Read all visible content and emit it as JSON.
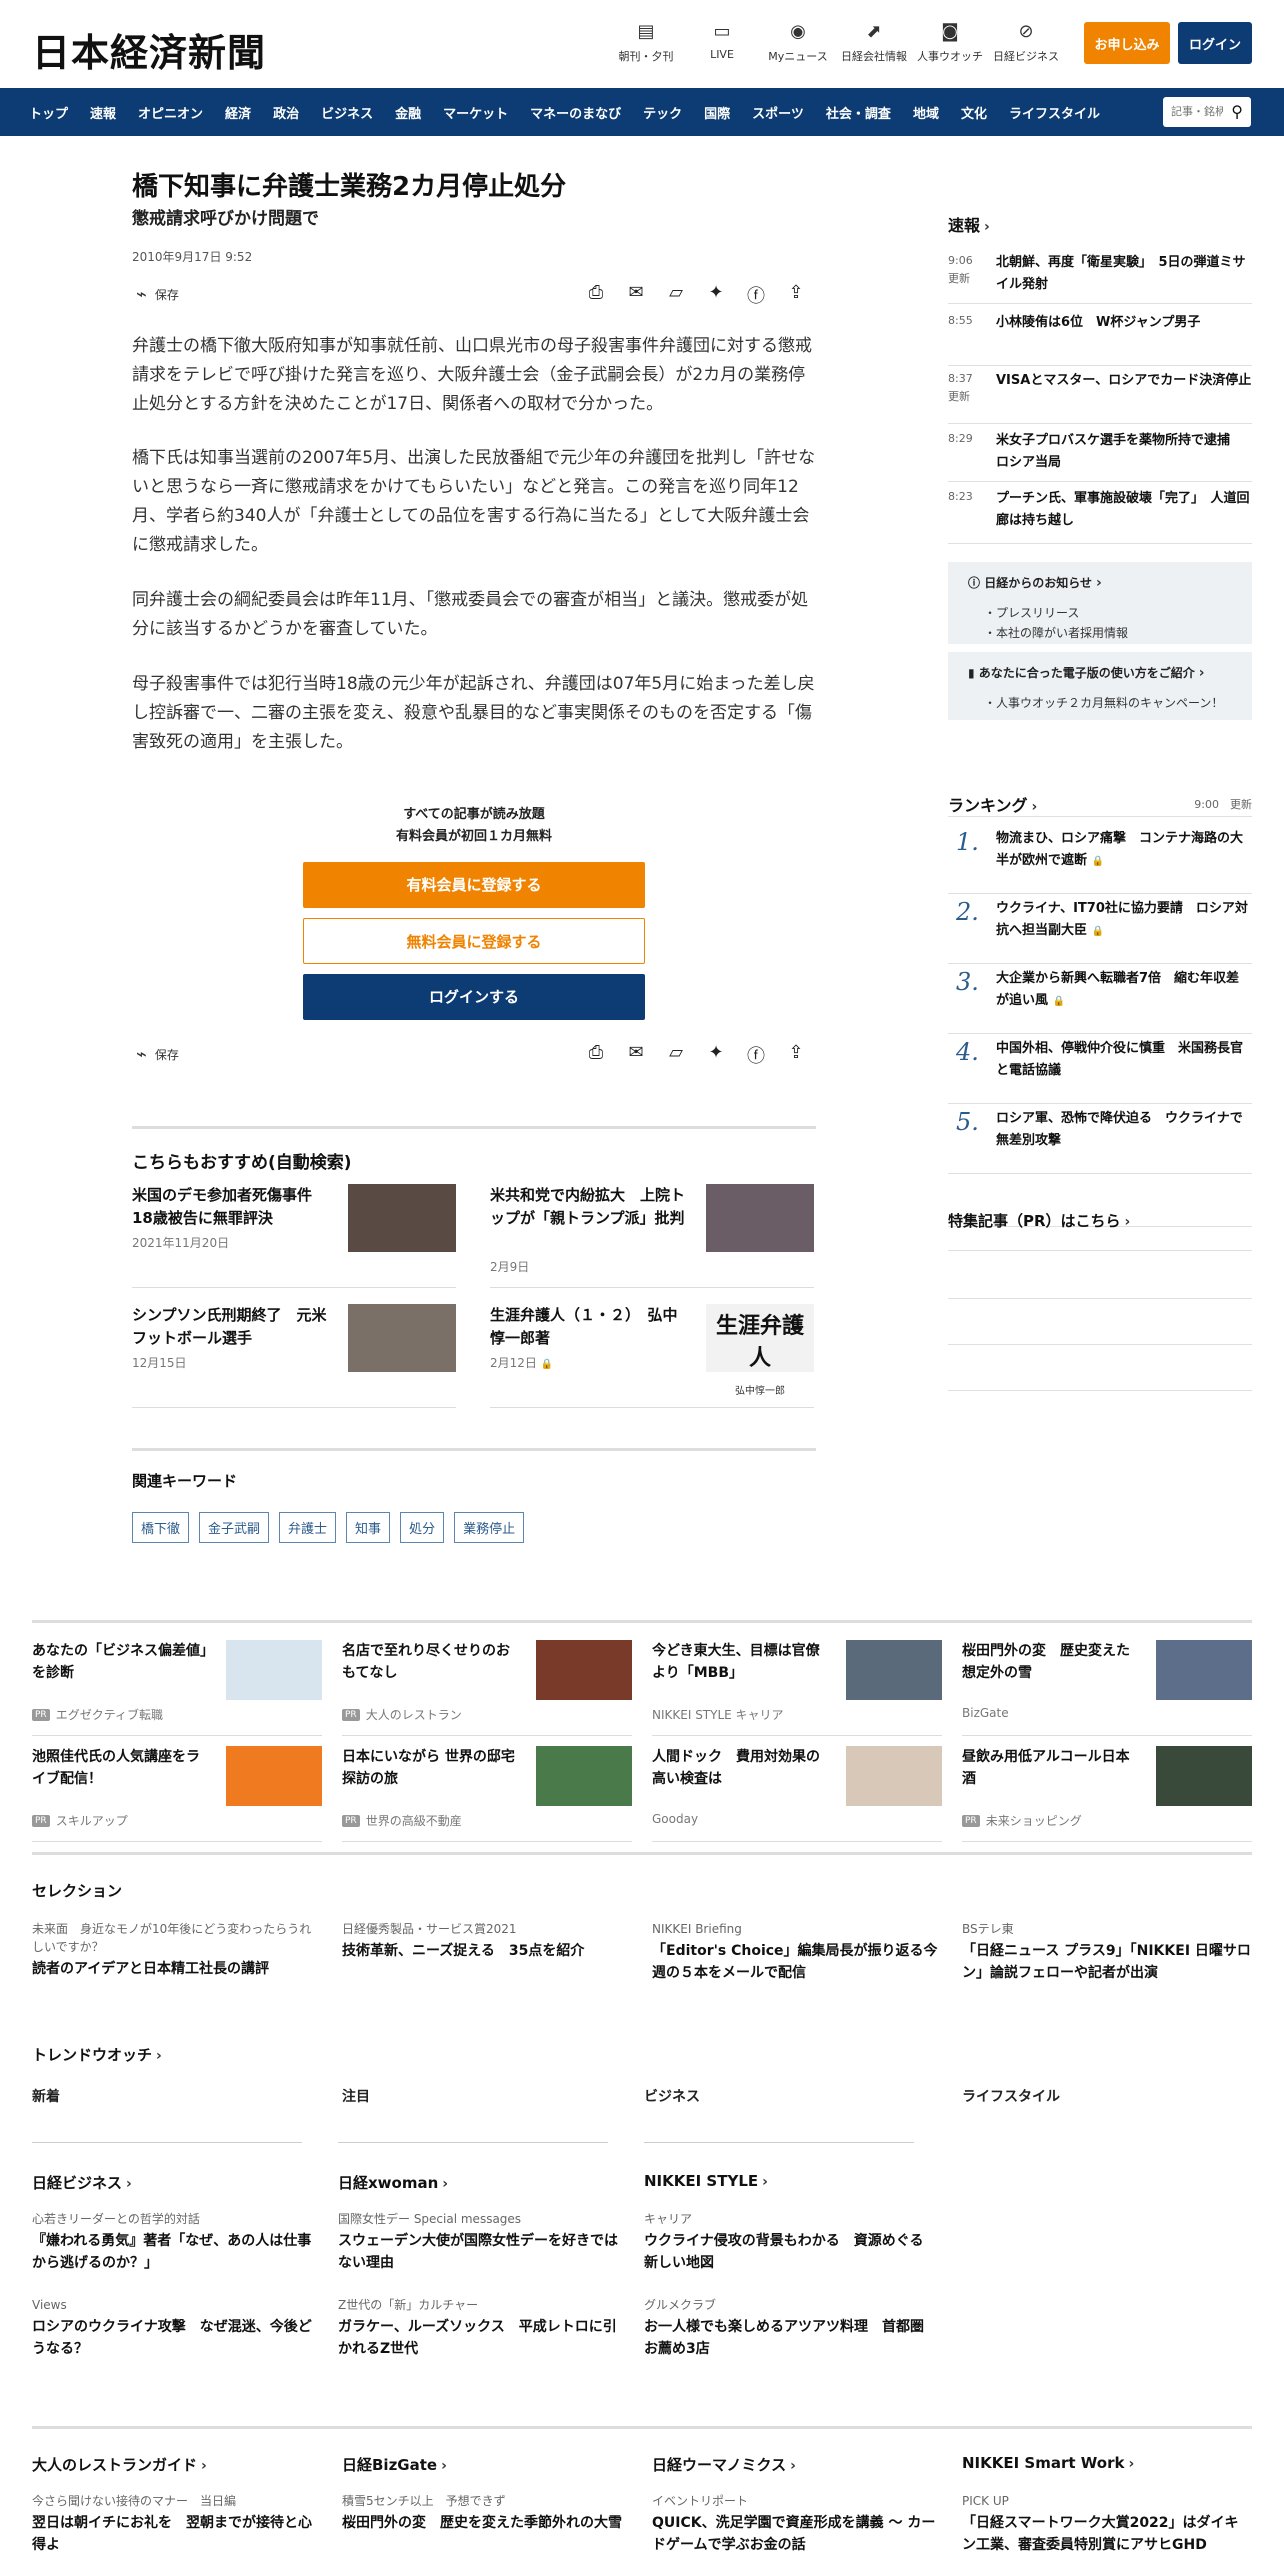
{
  "header": {
    "logo": "日本経済新聞",
    "links": [
      {
        "label": "朝刊・夕刊",
        "icon": "newspaper-icon"
      },
      {
        "label": "LIVE",
        "icon": "video-icon"
      },
      {
        "label": "Myニュース",
        "icon": "user-icon"
      },
      {
        "label": "日経会社情報",
        "icon": "chart-icon"
      },
      {
        "label": "人事ウオッチ",
        "icon": "search-person-icon"
      },
      {
        "label": "日経ビジネス",
        "icon": "compass-icon"
      }
    ],
    "apply_label": "お申し込み",
    "login_label": "ログイン"
  },
  "nav": {
    "items": [
      "トップ",
      "速報",
      "オピニオン",
      "経済",
      "政治",
      "ビジネス",
      "金融",
      "マーケット",
      "マネーのまなび",
      "テック",
      "国際",
      "スポーツ",
      "社会・調査",
      "地域",
      "文化",
      "ライフスタイル"
    ],
    "search_placeholder": "記事・銘柄"
  },
  "article": {
    "title": "橋下知事に弁護士業務2カ月停止処分",
    "subtitle": "懲戒請求呼びかけ問題で",
    "date": "2010年9月17日 9:52",
    "save_label": "保存",
    "paragraphs": [
      "弁護士の橋下徹大阪府知事が知事就任前、山口県光市の母子殺害事件弁護団に対する懲戒請求をテレビで呼び掛けた発言を巡り、大阪弁護士会（金子武嗣会長）が2カ月の業務停止処分とする方針を決めたことが17日、関係者への取材で分かった。",
      "橋下氏は知事当選前の2007年5月、出演した民放番組で元少年の弁護団を批判し「許せないと思うなら一斉に懲戒請求をかけてもらいたい」などと発言。この発言を巡り同年12月、学者ら約340人が「弁護士としての品位を害する行為に当たる」として大阪弁護士会に懲戒請求した。",
      "同弁護士会の綱紀委員会は昨年11月、「懲戒委員会での審査が相当」と議決。懲戒委が処分に該当するかどうかを審査していた。",
      "母子殺害事件では犯行当時18歳の元少年が起訴され、弁護団は07年5月に始まった差し戻し控訴審で一、二審の主張を変え、殺意や乱暴目的など事実関係そのものを否定する「傷害致死の適用」を主張した。"
    ],
    "paywall": {
      "line1": "すべての記事が読み放題",
      "line2": "有料会員が初回１カ月無料",
      "paid": "有料会員に登録する",
      "free": "無料会員に登録する",
      "login": "ログインする"
    },
    "recommend_title": "こちらもおすすめ(自動検索)",
    "recommend": [
      {
        "title": "米国のデモ参加者死傷事件18歳被告に無罪評決",
        "date": "2021年11月20日",
        "color": "#5a4a44"
      },
      {
        "title": "米共和党で内紛拡大　上院トップが「親トランプ派」批判",
        "date": "2月9日",
        "color": "#6b5d66"
      },
      {
        "title": "シンプソン氏刑期終了　元米フットボール選手",
        "date": "12月15日",
        "color": "#7b7068"
      },
      {
        "title": "生涯弁護人（１・２）　弘中惇一郎著",
        "date": "2月12日",
        "color": "#e8e8e8",
        "img_text": "生涯弁護人",
        "img_sub": "弘中惇一郎"
      }
    ],
    "keywords_title": "関連キーワード",
    "keywords": [
      "橋下徹",
      "金子武嗣",
      "弁護士",
      "知事",
      "処分",
      "業務停止"
    ]
  },
  "side": {
    "flash_title": "速報",
    "flash": [
      {
        "time": "9:06",
        "updated": "更新",
        "text": "北朝鮮、再度「衛星実験」　5日の弾道ミサイル発射"
      },
      {
        "time": "8:55",
        "updated": "",
        "text": "小林陵侑は6位　W杯ジャンプ男子"
      },
      {
        "time": "8:37",
        "updated": "更新",
        "text": "VISAとマスター、ロシアでカード決済停止"
      },
      {
        "time": "8:29",
        "updated": "",
        "text": "米女子プロバスケ選手を薬物所持で逮捕　ロシア当局"
      },
      {
        "time": "8:23",
        "updated": "",
        "text": "プーチン氏、軍事施設破壊「完了」　人道回廊は持ち越し"
      }
    ],
    "notice_title": "日経からのお知らせ",
    "notice_items": [
      "プレスリリース",
      "本社の障がい者採用情報"
    ],
    "ebook_title": "あなたに合った電子版の使い方をご紹介",
    "ebook_items": [
      "人事ウオッチ２カ月無料のキャンペーン！"
    ],
    "ranking_title": "ランキング",
    "ranking_time": "9:00",
    "ranking_updated": "更新",
    "ranking": [
      {
        "num": "1.",
        "text": "物流まひ、ロシア痛撃　コンテナ海路の大半が欧州で遮断",
        "lock": true
      },
      {
        "num": "2.",
        "text": "ウクライナ、IT70社に協力要請　ロシア対抗へ担当副大臣",
        "lock": true
      },
      {
        "num": "3.",
        "text": "大企業から新興へ転職者7倍　縮む年収差が追い風",
        "lock": true
      },
      {
        "num": "4.",
        "text": "中国外相、停戦仲介役に慎重　米国務長官と電話協議",
        "lock": false
      },
      {
        "num": "5.",
        "text": "ロシア軍、恐怖で降伏迫る　ウクライナで無差別攻撃",
        "lock": false
      }
    ],
    "pr_title": "特集記事（PR）はこちら"
  },
  "promos": [
    {
      "title": "あなたの「ビジネス偏差値」を診断",
      "pr": true,
      "src": "エグゼクティブ転職",
      "color": "#d8e4ee"
    },
    {
      "title": "名店で至れり尽くせりのおもてなし",
      "pr": true,
      "src": "大人のレストラン",
      "color": "#7a3a2a"
    },
    {
      "title": "今どき東大生、目標は官僚より「MBB」",
      "pr": false,
      "src": "NIKKEI STYLE キャリア",
      "color": "#5a6a7a"
    },
    {
      "title": "桜田門外の変　歴史変えた想定外の雪",
      "pr": false,
      "src": "BizGate",
      "color": "#5c6e8a"
    },
    {
      "title": "池照佳代氏の人気講座をライブ配信！",
      "pr": true,
      "src": "スキルアップ",
      "color": "#f07a20"
    },
    {
      "title": "日本にいながら 世界の邸宅探訪の旅",
      "pr": true,
      "src": "世界の高級不動産",
      "color": "#4a7a4a"
    },
    {
      "title": "人間ドック　費用対効果の高い検査は",
      "pr": false,
      "src": "Gooday",
      "color": "#d8c8b8"
    },
    {
      "title": "昼飲み用低アルコール日本酒",
      "pr": true,
      "src": "未来ショッピング",
      "color": "#3a4a3a"
    }
  ],
  "selection": {
    "title": "セレクション",
    "items": [
      {
        "cat": "未来面　身近なモノが10年後にどう変わったらうれしいですか？",
        "title": "読者のアイデアと日本精工社長の講評"
      },
      {
        "cat": "日経優秀製品・サービス賞2021",
        "title": "技術革新、ニーズ捉える　35点を紹介"
      },
      {
        "cat": "NIKKEI Briefing",
        "title": "「Editor's Choice」編集局長が振り返る今週の５本をメールで配信"
      },
      {
        "cat": "BSテレ東",
        "title": "「日経ニュース プラス9」「NIKKEI 日曜サロン」論説フェローや記者が出演"
      }
    ]
  },
  "trend": {
    "title": "トレンドウオッチ",
    "cols": [
      "新着",
      "注目",
      "ビジネス",
      "ライフスタイル"
    ]
  },
  "media": [
    {
      "head": "日経ビジネス",
      "items": [
        {
          "cat": "心若きリーダーとの哲学的対話",
          "title": "『嫌われる勇気』著者「なぜ、あの人は仕事から逃げるのか？」"
        },
        {
          "cat": "Views",
          "title": "ロシアのウクライナ攻撃　なぜ混迷、今後どうなる？"
        }
      ]
    },
    {
      "head": "日経xwoman",
      "items": [
        {
          "cat": "国際女性デー Special messages",
          "title": "スウェーデン大使が国際女性デーを好きではない理由"
        },
        {
          "cat": "Z世代の「新」カルチャー",
          "title": "ガラケー、ルーズソックス　平成レトロに引かれるZ世代"
        }
      ]
    },
    {
      "head": "NIKKEI STYLE",
      "items": [
        {
          "cat": "キャリア",
          "title": "ウクライナ侵攻の背景もわかる　資源めぐる新しい地図"
        },
        {
          "cat": "グルメクラブ",
          "title": "お一人様でも楽しめるアツアツ料理　首都圏お薦め3店"
        }
      ]
    }
  ],
  "media2": [
    {
      "head": "大人のレストランガイド",
      "cat": "今さら聞けない接待のマナー　当日編",
      "title": "翌日は朝イチにお礼を　翌朝までが接待と心得よ"
    },
    {
      "head": "日経BizGate",
      "cat": "積雪5センチ以上　予想できず",
      "title": "桜田門外の変　歴史を変えた季節外れの大雪"
    },
    {
      "head": "日経ウーマノミクス",
      "cat": "イベントリポート",
      "title": "QUICK、洗足学園で資産形成を講義 ～ カードゲームで学ぶお金の話"
    },
    {
      "head": "NIKKEI Smart Work",
      "cat": "PICK UP",
      "title": "「日経スマートワーク大賞2022」はダイキン工業、審査委員特別賞にアサヒGHD"
    }
  ]
}
